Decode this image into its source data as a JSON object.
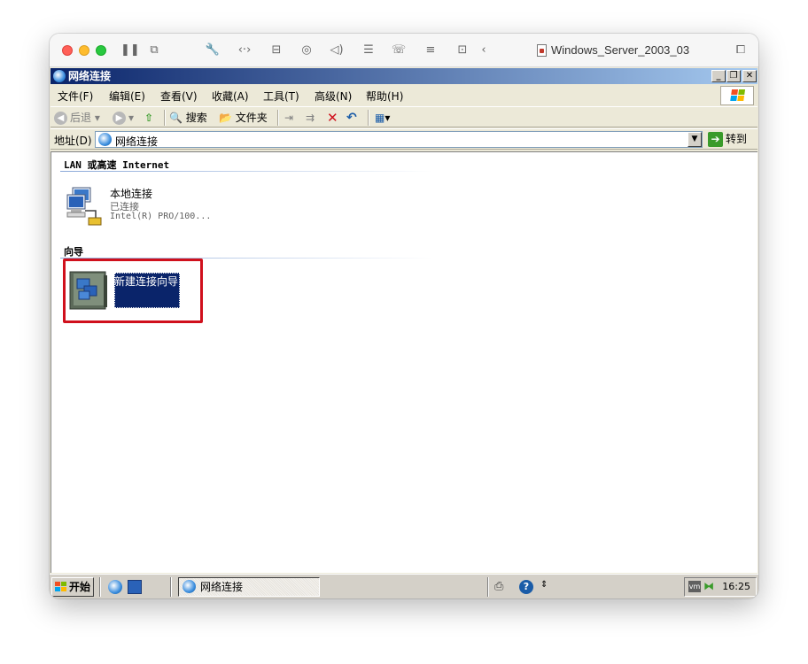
{
  "mac": {
    "title": "Windows_Server_2003_03",
    "icons": [
      "pause-icon",
      "snapshot-icon",
      "wrench-icon",
      "code-arrows-icon",
      "drive-icon",
      "user-icon",
      "speaker-icon",
      "disk-icon",
      "phone-icon",
      "stack-icon",
      "folder-icon",
      "back-chevron-icon",
      "window-copy-icon"
    ]
  },
  "window": {
    "title": "网络连接"
  },
  "menu": {
    "items": [
      "文件(F)",
      "编辑(E)",
      "查看(V)",
      "收藏(A)",
      "工具(T)",
      "高级(N)",
      "帮助(H)"
    ]
  },
  "toolbar": {
    "back": "后退",
    "search": "搜索",
    "folders": "文件夹"
  },
  "address": {
    "label": "地址(D)",
    "value": "网络连接",
    "go": "转到"
  },
  "content": {
    "group_lan": "LAN 或高速 Internet",
    "local_connection": {
      "name": "本地连接",
      "status": "已连接",
      "device": "Intel(R) PRO/100..."
    },
    "group_wizard": "向导",
    "new_connection_wizard": "新建连接向导"
  },
  "taskbar": {
    "start": "开始",
    "task": "网络连接",
    "clock": "16:25"
  },
  "colors": {
    "selection": "#0a246a",
    "highlight_box": "#d0101c",
    "titlebar_start": "#0a246a",
    "titlebar_end": "#a6caf0"
  }
}
